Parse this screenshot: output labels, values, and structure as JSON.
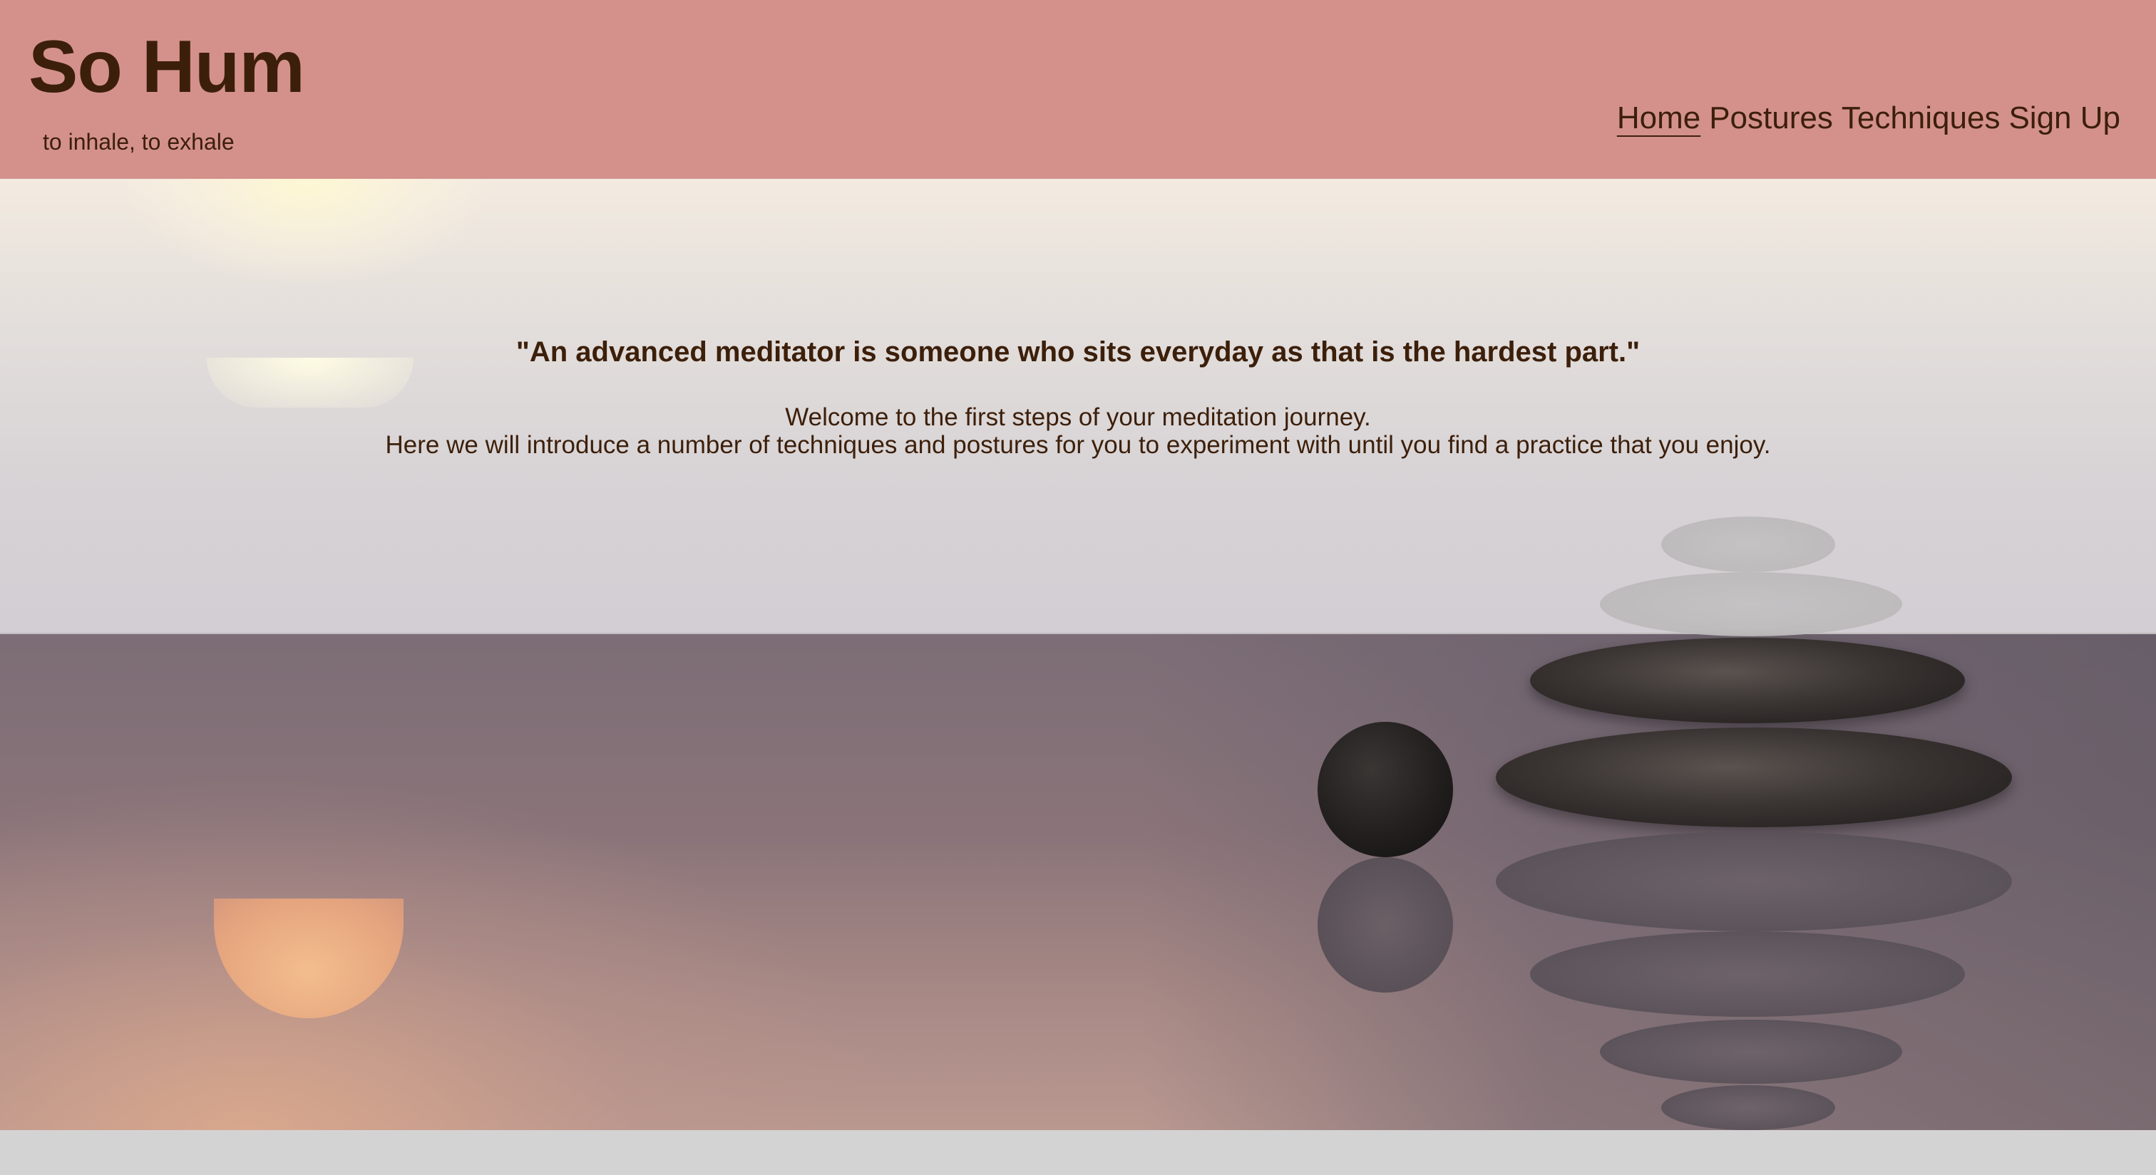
{
  "header": {
    "title": "So Hum",
    "tagline": "to inhale, to exhale",
    "nav": [
      {
        "label": "Home",
        "active": true
      },
      {
        "label": "Postures",
        "active": false
      },
      {
        "label": "Techniques",
        "active": false
      },
      {
        "label": "Sign Up",
        "active": false
      }
    ]
  },
  "hero": {
    "quote": "\"An advanced meditator is someone who sits everyday as that is the hardest part.\"",
    "welcome_line1": "Welcome to the first steps of your meditation journey.",
    "welcome_line2": "Here we will introduce a number of techniques and postures for you to experiment with until you find a practice that you enjoy."
  },
  "colors": {
    "header_bg": "#d4918c",
    "text": "#3c1f0a"
  }
}
